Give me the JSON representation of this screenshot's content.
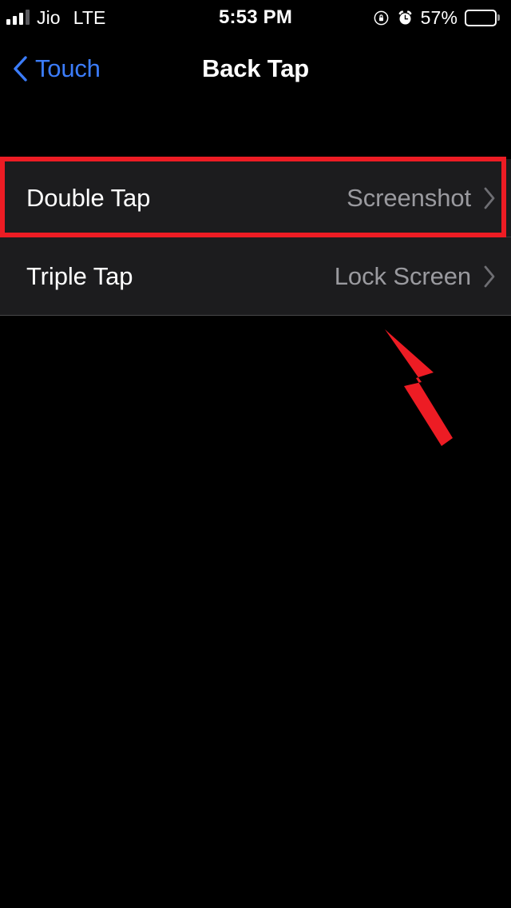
{
  "status_bar": {
    "carrier": "Jio",
    "network": "LTE",
    "time": "5:53 PM",
    "battery_percent": "57%",
    "battery_level": 57,
    "icons": {
      "signal": "signal-bars-icon",
      "rotation_lock": "rotation-lock-icon",
      "alarm": "alarm-clock-icon",
      "battery": "battery-icon"
    }
  },
  "nav_bar": {
    "back_label": "Touch",
    "back_icon": "chevron-left-icon",
    "title": "Back Tap"
  },
  "settings_rows": [
    {
      "label": "Double Tap",
      "value": "Screenshot",
      "chevron": "chevron-right-icon",
      "highlighted": true
    },
    {
      "label": "Triple Tap",
      "value": "Lock Screen",
      "chevron": "chevron-right-icon",
      "highlighted": false
    }
  ],
  "annotations": {
    "highlight_box_color": "#ed1c24",
    "arrow_color": "#ed1c24",
    "arrow_direction": "up-left"
  },
  "colors": {
    "background": "#000000",
    "row_background": "#1c1c1e",
    "primary_text": "#ffffff",
    "secondary_text": "#9a9a9f",
    "accent_blue": "#3b7cfa",
    "separator": "#3a3a3c",
    "annotation_red": "#ed1c24"
  }
}
